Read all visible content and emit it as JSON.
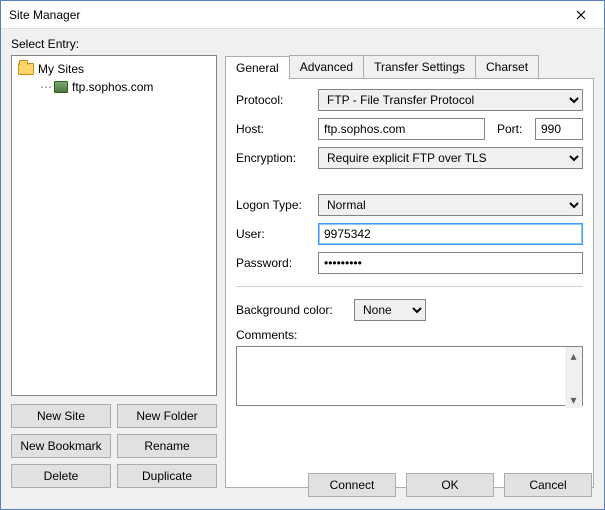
{
  "window": {
    "title": "Site Manager"
  },
  "left": {
    "select_entry_label": "Select Entry:",
    "root_label": "My Sites",
    "site_label": "ftp.sophos.com",
    "buttons": {
      "new_site": "New Site",
      "new_folder": "New Folder",
      "new_bookmark": "New Bookmark",
      "rename": "Rename",
      "delete": "Delete",
      "duplicate": "Duplicate"
    }
  },
  "tabs": {
    "general": "General",
    "advanced": "Advanced",
    "transfer": "Transfer Settings",
    "charset": "Charset"
  },
  "form": {
    "protocol_label": "Protocol:",
    "protocol_value": "FTP - File Transfer Protocol",
    "host_label": "Host:",
    "host_value": "ftp.sophos.com",
    "port_label": "Port:",
    "port_value": "990",
    "encryption_label": "Encryption:",
    "encryption_value": "Require explicit FTP over TLS",
    "logon_label": "Logon Type:",
    "logon_value": "Normal",
    "user_label": "User:",
    "user_value": "9975342",
    "password_label": "Password:",
    "password_value": "•••••••••",
    "bg_label": "Background color:",
    "bg_value": "None",
    "comments_label": "Comments:"
  },
  "footer": {
    "connect": "Connect",
    "ok": "OK",
    "cancel": "Cancel"
  }
}
